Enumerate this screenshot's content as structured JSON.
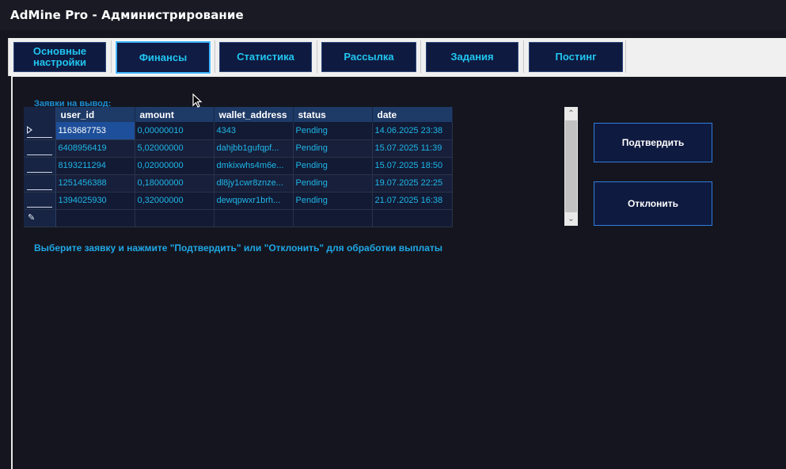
{
  "window": {
    "title": "AdMine Pro - Администрирование"
  },
  "tabs": [
    {
      "label": "Основные настройки",
      "active": false
    },
    {
      "label": "Финансы",
      "active": true
    },
    {
      "label": "Статистика",
      "active": false
    },
    {
      "label": "Рассылка",
      "active": false
    },
    {
      "label": "Задания",
      "active": false
    },
    {
      "label": "Постинг",
      "active": false
    }
  ],
  "finance": {
    "grid_title": "Заявки на вывод:",
    "columns": [
      "user_id",
      "amount",
      "wallet_address",
      "status",
      "date"
    ],
    "rows": [
      {
        "user_id": "1163687753",
        "amount": "0,00000010",
        "wallet_address": "4343",
        "status": "Pending",
        "date": "14.06.2025 23:38"
      },
      {
        "user_id": "6408956419",
        "amount": "5,02000000",
        "wallet_address": "dahjbb1gufqpf...",
        "status": "Pending",
        "date": "15.07.2025 11:39"
      },
      {
        "user_id": "8193211294",
        "amount": "0,02000000",
        "wallet_address": "dmkixwhs4m6e...",
        "status": "Pending",
        "date": "15.07.2025 18:50"
      },
      {
        "user_id": "1251456388",
        "amount": "0,18000000",
        "wallet_address": "dl8jy1cwr8znze...",
        "status": "Pending",
        "date": "19.07.2025 22:25"
      },
      {
        "user_id": "1394025930",
        "amount": "0,32000000",
        "wallet_address": "dewqpwxr1brh...",
        "status": "Pending",
        "date": "21.07.2025 16:38"
      }
    ],
    "confirm_button": "Подтвердить",
    "reject_button": "Отклонить",
    "hint": "Выберите заявку и нажмите \"Подтвердить\" или \"Отклонить\" для обработки выплаты"
  },
  "colors": {
    "accent": "#20c6f0",
    "tab_bg": "#0f1a40",
    "selected_cell": "#1d4f9a",
    "header_bg": "#1e3a66"
  }
}
